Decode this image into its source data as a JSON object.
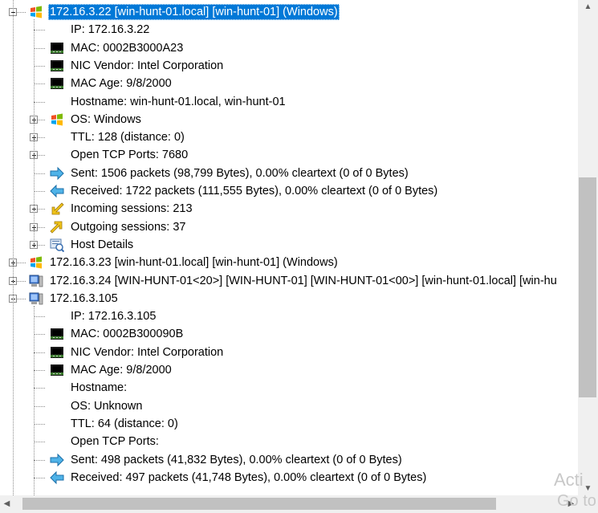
{
  "tree": {
    "nodes": [
      {
        "label": "172.16.3.22 [win-hunt-01.local] [win-hunt-01] (Windows)",
        "icon": "windows-logo-icon",
        "level": 0,
        "expander": "minus",
        "selected": true
      },
      {
        "label": "IP: 172.16.3.22",
        "icon": "none",
        "level": 1,
        "expander": "none"
      },
      {
        "label": "MAC: 0002B3000A23",
        "icon": "network-card-icon",
        "level": 1,
        "expander": "none"
      },
      {
        "label": "NIC Vendor: Intel Corporation",
        "icon": "network-card-icon",
        "level": 1,
        "expander": "none"
      },
      {
        "label": "MAC Age: 9/8/2000",
        "icon": "network-card-icon",
        "level": 1,
        "expander": "none"
      },
      {
        "label": "Hostname: win-hunt-01.local, win-hunt-01",
        "icon": "none",
        "level": 1,
        "expander": "none"
      },
      {
        "label": "OS: Windows",
        "icon": "windows-logo-icon",
        "level": 1,
        "expander": "plus"
      },
      {
        "label": "TTL: 128 (distance: 0)",
        "icon": "none",
        "level": 1,
        "expander": "plus"
      },
      {
        "label": "Open TCP Ports: 7680",
        "icon": "none",
        "level": 1,
        "expander": "plus"
      },
      {
        "label": "Sent: 1506 packets (98,799 Bytes), 0.00% cleartext (0 of 0 Bytes)",
        "icon": "sent-arrow-icon",
        "level": 1,
        "expander": "none"
      },
      {
        "label": "Received: 1722 packets (111,555 Bytes), 0.00% cleartext (0 of 0 Bytes)",
        "icon": "received-arrow-icon",
        "level": 1,
        "expander": "none"
      },
      {
        "label": "Incoming sessions: 213",
        "icon": "incoming-sessions-icon",
        "level": 1,
        "expander": "plus"
      },
      {
        "label": "Outgoing sessions: 37",
        "icon": "outgoing-sessions-icon",
        "level": 1,
        "expander": "plus"
      },
      {
        "label": "Host Details",
        "icon": "host-details-icon",
        "level": 1,
        "expander": "plus"
      },
      {
        "label": "172.16.3.23 [win-hunt-01.local] [win-hunt-01] (Windows)",
        "icon": "windows-logo-icon",
        "level": 0,
        "expander": "plus"
      },
      {
        "label": "172.16.3.24 [WIN-HUNT-01<20>] [WIN-HUNT-01] [WIN-HUNT-01<00>] [win-hunt-01.local] [win-hu",
        "icon": "computer-icon",
        "level": 0,
        "expander": "plus"
      },
      {
        "label": "172.16.3.105",
        "icon": "computer-icon",
        "level": 0,
        "expander": "minus"
      },
      {
        "label": "IP: 172.16.3.105",
        "icon": "none",
        "level": 1,
        "expander": "none"
      },
      {
        "label": "MAC: 0002B300090B",
        "icon": "network-card-icon",
        "level": 1,
        "expander": "none"
      },
      {
        "label": "NIC Vendor: Intel Corporation",
        "icon": "network-card-icon",
        "level": 1,
        "expander": "none"
      },
      {
        "label": "MAC Age: 9/8/2000",
        "icon": "network-card-icon",
        "level": 1,
        "expander": "none"
      },
      {
        "label": "Hostname:",
        "icon": "none",
        "level": 1,
        "expander": "none"
      },
      {
        "label": "OS: Unknown",
        "icon": "none",
        "level": 1,
        "expander": "none"
      },
      {
        "label": "TTL: 64 (distance: 0)",
        "icon": "none",
        "level": 1,
        "expander": "none"
      },
      {
        "label": "Open TCP Ports:",
        "icon": "none",
        "level": 1,
        "expander": "none"
      },
      {
        "label": "Sent: 498 packets (41,832 Bytes), 0.00% cleartext (0 of 0 Bytes)",
        "icon": "sent-arrow-icon",
        "level": 1,
        "expander": "none"
      },
      {
        "label": "Received: 497 packets (41,748 Bytes), 0.00% cleartext (0 of 0 Bytes)",
        "icon": "received-arrow-icon",
        "level": 1,
        "expander": "none"
      }
    ]
  },
  "scrollbars": {
    "up_arrow": "▲",
    "down_arrow": "▼",
    "left_arrow": "◀",
    "right_arrow": "▶"
  },
  "watermark": {
    "line1": "Acti",
    "line2": "Go to"
  },
  "colors": {
    "selection": "#0078d7",
    "tree_lines": "#8c8c8c"
  }
}
